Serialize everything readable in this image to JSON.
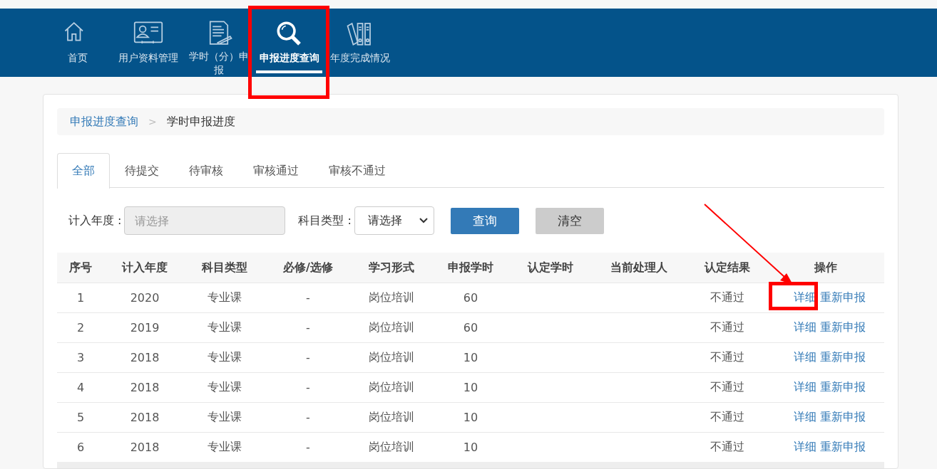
{
  "nav": {
    "items": [
      {
        "label": "首页",
        "selected": false
      },
      {
        "label": "用户资料管理",
        "selected": false
      },
      {
        "label": "学时（分）申报",
        "selected": false
      },
      {
        "label": "申报进度查询",
        "selected": true
      },
      {
        "label": "年度完成情况",
        "selected": false
      }
    ]
  },
  "breadcrumb": {
    "items": [
      {
        "label": "申报进度查询",
        "kind": "link"
      },
      {
        "label": "学时申报进度",
        "kind": "current"
      }
    ],
    "separator": ">"
  },
  "tabs": [
    {
      "label": "全部",
      "selected": true
    },
    {
      "label": "待提交",
      "selected": false
    },
    {
      "label": "待审核",
      "selected": false
    },
    {
      "label": "审核通过",
      "selected": false
    },
    {
      "label": "审核不通过",
      "selected": false
    }
  ],
  "filters": {
    "year": {
      "label": "计入年度 :",
      "placeholder": "请选择"
    },
    "subject_type": {
      "label": "科目类型 :",
      "value": "请选择"
    }
  },
  "buttons": [
    {
      "label": "查询",
      "kind": "primary"
    },
    {
      "label": "清空",
      "kind": "default"
    }
  ],
  "table": {
    "columns": [
      "序号",
      "计入年度",
      "科目类型",
      "必修/选修",
      "学习形式",
      "申报学时",
      "认定学时",
      "当前处理人",
      "认定结果",
      "操作"
    ],
    "rows": [
      {
        "index": "1",
        "year": "2020",
        "subject_type": "专业课",
        "required": "-",
        "form": "岗位培训",
        "hours": "60",
        "result": "不通过",
        "actions": [
          "详细",
          "重新申报"
        ]
      },
      {
        "index": "2",
        "year": "2019",
        "subject_type": "专业课",
        "required": "-",
        "form": "岗位培训",
        "hours": "60",
        "result": "不通过",
        "actions": [
          "详细",
          "重新申报"
        ]
      },
      {
        "index": "3",
        "year": "2018",
        "subject_type": "专业课",
        "required": "-",
        "form": "岗位培训",
        "hours": "10",
        "result": "不通过",
        "actions": [
          "详细",
          "重新申报"
        ]
      },
      {
        "index": "4",
        "year": "2018",
        "subject_type": "专业课",
        "required": "-",
        "form": "岗位培训",
        "hours": "10",
        "result": "不通过",
        "actions": [
          "详细",
          "重新申报"
        ]
      },
      {
        "index": "5",
        "year": "2018",
        "subject_type": "专业课",
        "required": "-",
        "form": "岗位培训",
        "hours": "10",
        "result": "不通过",
        "actions": [
          "详细",
          "重新申报"
        ]
      },
      {
        "index": "6",
        "year": "2018",
        "subject_type": "专业课",
        "required": "-",
        "form": "岗位培训",
        "hours": "10",
        "result": "不通过",
        "actions": [
          "详细",
          "重新申报"
        ]
      }
    ]
  }
}
